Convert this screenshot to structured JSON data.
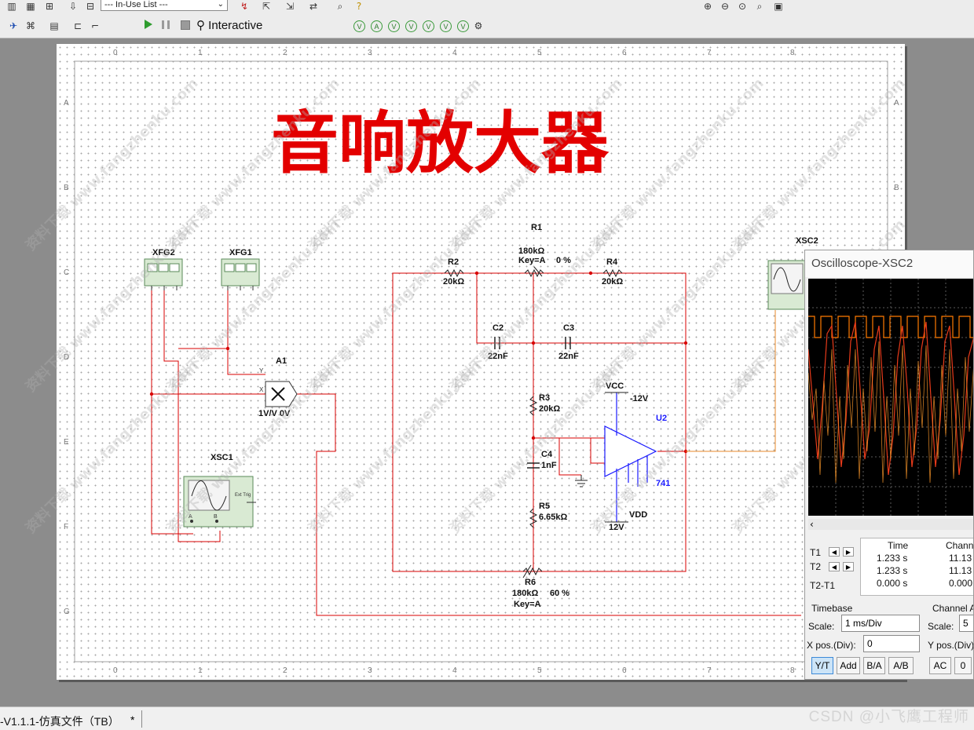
{
  "toolbar": {
    "in_use_list": "--- In-Use List ---",
    "sim_mode": "Interactive",
    "instrument_icons": [
      "V",
      "A",
      "V",
      "V",
      "V",
      "V",
      "V"
    ]
  },
  "sheet": {
    "title": "音响放大器",
    "border_cols": [
      "0",
      "1",
      "2",
      "3",
      "4",
      "5",
      "6",
      "7",
      "8"
    ],
    "border_rows": [
      "A",
      "B",
      "C",
      "D",
      "E",
      "F",
      "G"
    ]
  },
  "watermark_text": "资料下载 www.fangzhenku.com",
  "components": {
    "xfg2": "XFG2",
    "xfg1": "XFG1",
    "a1_name": "A1",
    "a1_value": "1V/V 0V",
    "a1_x": "X",
    "a1_y": "Y",
    "xsc1": "XSC1",
    "xsc1_ext": "Ext Trig",
    "xsc1_a": "A",
    "xsc1_b": "B",
    "r1_name": "R1",
    "r1_value": "180kΩ",
    "r1_key": "Key=A",
    "r1_pct": "0 %",
    "r2_name": "R2",
    "r2_value": "20kΩ",
    "r4_name": "R4",
    "r4_value": "20kΩ",
    "c2_name": "C2",
    "c2_value": "22nF",
    "c3_name": "C3",
    "c3_value": "22nF",
    "r3_name": "R3",
    "r3_value": "20kΩ",
    "c4_name": "C4",
    "c4_value": "1nF",
    "r5_name": "R5",
    "r5_value": "6.65kΩ",
    "r6_name": "R6",
    "r6_value": "180kΩ",
    "r6_pct": "60 %",
    "r6_key": "Key=A",
    "vcc": "VCC",
    "vcc_v": "-12V",
    "vdd": "VDD",
    "vdd_v": "12V",
    "u2": "U2",
    "u2_model": "741",
    "xsc2": "XSC2"
  },
  "oscilloscope": {
    "title": "Oscilloscope-XSC2",
    "cursor_t1": "T1",
    "cursor_t2": "T2",
    "cursor_diff": "T2-T1",
    "col_time": "Time",
    "col_channel": "Channe",
    "t1_time": "1.233 s",
    "t2_time": "1.233 s",
    "diff_time": "0.000 s",
    "t1_ch": "11.13",
    "t2_ch": "11.13",
    "diff_ch": "0.000",
    "timebase_label": "Timebase",
    "channel_label": "Channel A",
    "scale_label": "Scale:",
    "scale_value": "1 ms/Div",
    "xpos_label": "X pos.(Div):",
    "xpos_value": "0",
    "ch_scale_label": "Scale:",
    "ch_scale_value": "5",
    "ypos_label": "Y pos.(Div):",
    "btn_yt": "Y/T",
    "btn_add": "Add",
    "btn_ba": "B/A",
    "btn_ab": "A/B",
    "btn_ac": "AC",
    "btn_zero": "0"
  },
  "statusbar": {
    "tab_title": "-V1.1.1-仿真文件（TB）",
    "modified": "*"
  },
  "csdn_watermark": "CSDN @小飞鹰工程师",
  "colors": {
    "title_red": "#e30000",
    "wire_red": "#d80000",
    "trace_orange": "#ff7a00",
    "wire_orange": "#e88a2a",
    "component_blue": "#1a1aff"
  }
}
